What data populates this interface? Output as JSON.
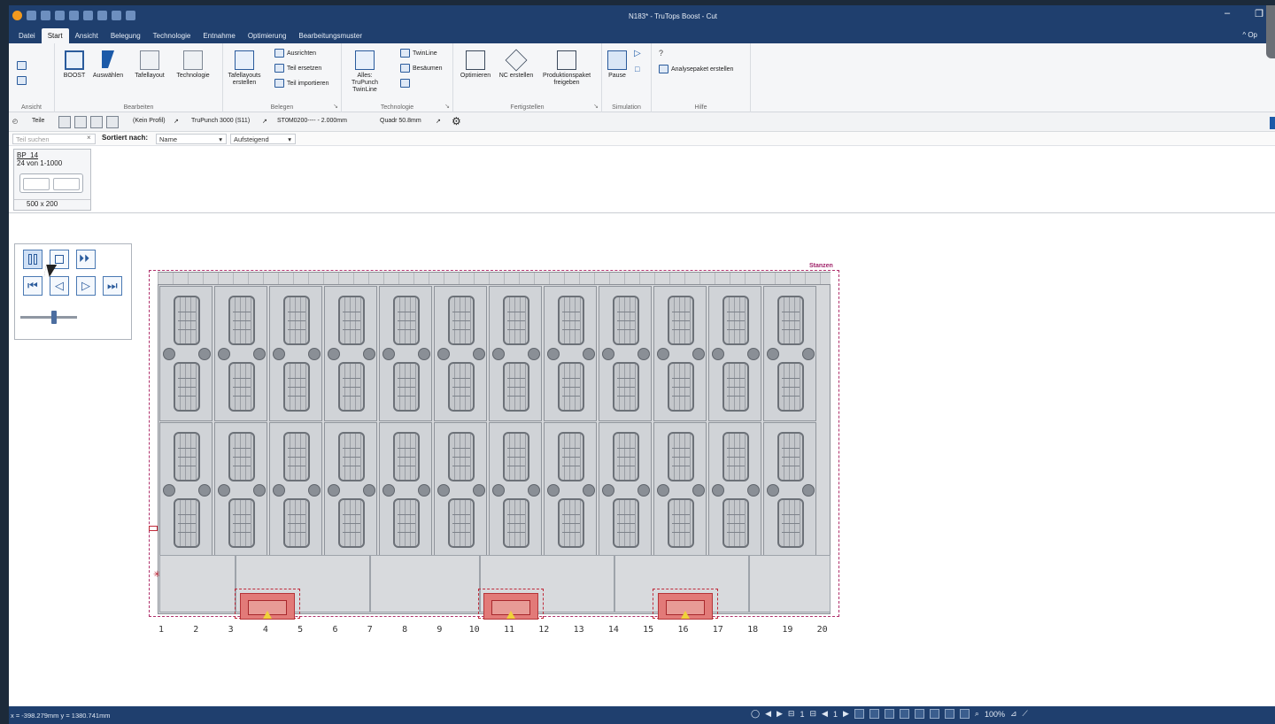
{
  "app": {
    "window_title": "N183* - TruTops Boost - Cut",
    "menu_tabs": [
      "Datei",
      "Start",
      "Ansicht",
      "Belegung",
      "Technologie",
      "Entnahme",
      "Optimierung",
      "Bearbeitungsmuster"
    ],
    "active_tab": "Start",
    "collapse_label": "^ Op"
  },
  "ribbon": {
    "groups": {
      "ansicht": "Ansicht",
      "bearbeiten": "Bearbeiten",
      "belegen": "Belegen",
      "technologie": "Technologie",
      "fertigstellen": "Fertigstellen",
      "simulation": "Simulation",
      "hilfe": "Hilfe"
    },
    "buttons": {
      "boost": "BOOST",
      "auswaehlen": "Auswählen",
      "tafellayout": "Tafellayout",
      "technologie": "Technologie",
      "tafellayouts_erstellen": "Tafellayouts erstellen",
      "ausrichten": "Ausrichten",
      "teil_ersetzen": "Teil ersetzen",
      "teil_importieren": "Teil importieren",
      "alles_trupunch": "Alles: TruPunch TwinLine",
      "twinline": "TwinLine",
      "besaeumen": "Besäumen",
      "optimieren": "Optimieren",
      "nc_erstellen": "NC erstellen",
      "produktionspaket": "Produktionspaket freigeben",
      "pause": "Pause",
      "analysepaket": "Analysepaket erstellen"
    }
  },
  "parts_bar": {
    "label": "Teile",
    "profile": "(Kein Profil)",
    "machine": "TruPunch 3000 (S11)",
    "material": "ST0M0200---- - 2.000mm",
    "tool": "Quadr 50.8mm"
  },
  "search": {
    "placeholder": "Teil suchen",
    "clear": "×",
    "sort_label": "Sortiert nach:",
    "sort_value": "Name",
    "order_value": "Aufsteigend"
  },
  "part_card": {
    "name": "BP_14",
    "quantity": "24 von 1-1000",
    "size": "500 x 200"
  },
  "sheet": {
    "label": "Stanzen",
    "ruler": [
      "1",
      "2",
      "3",
      "4",
      "5",
      "6",
      "7",
      "8",
      "9",
      "10",
      "11",
      "12",
      "13",
      "14",
      "15",
      "16",
      "17",
      "18",
      "19",
      "20"
    ]
  },
  "status": {
    "coords": "x = -398.279mm  y = 1380.741mm",
    "zoom": "100%",
    "page_a": "1",
    "page_b": "1"
  },
  "colors": {
    "titlebar": "#1f3f6e",
    "sheet_border": "#b0306b",
    "clamp_zone": "#e27a78"
  }
}
